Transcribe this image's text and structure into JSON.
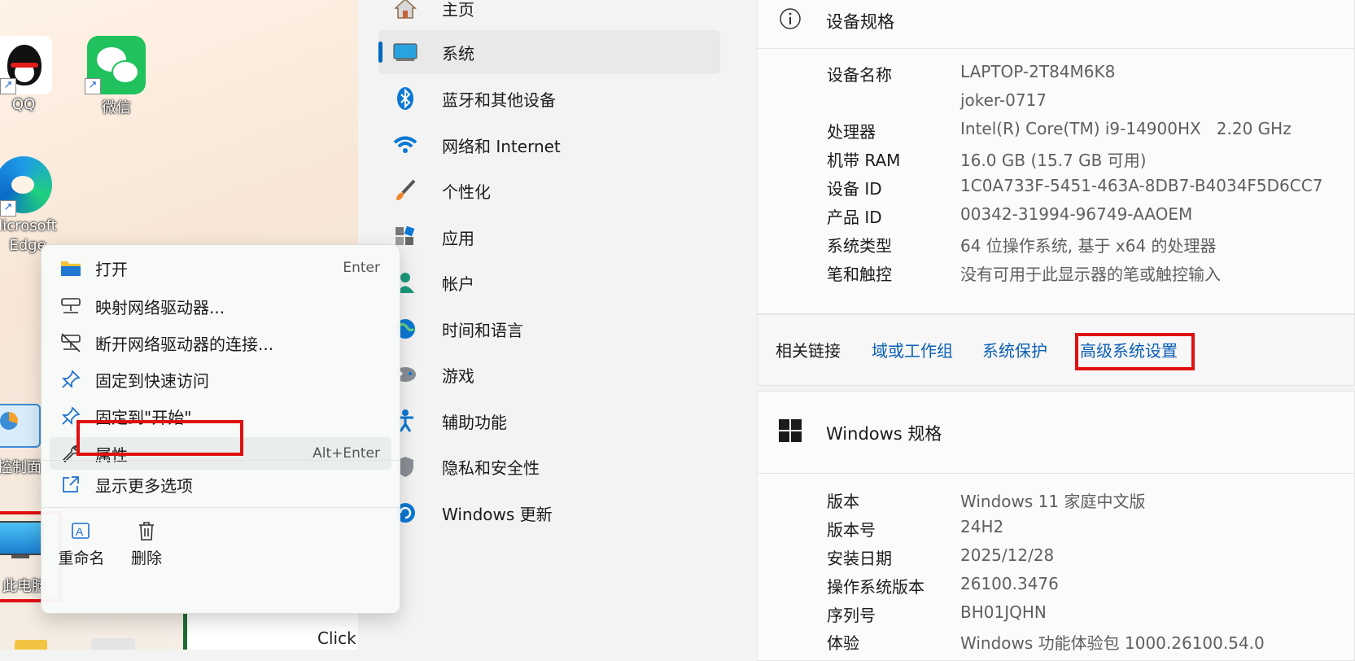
{
  "desktop": {
    "icons": [
      {
        "label": "QQ"
      },
      {
        "label": "微信"
      },
      {
        "label": "Microsoft Edge"
      },
      {
        "label": "控制面板"
      },
      {
        "label": "此电脑"
      }
    ],
    "edge_label_line1": "licrosoft",
    "edge_label_line2": "Edge",
    "cp_label": "控制面",
    "pc_label": "此电脑",
    "background_window_text": "Click"
  },
  "context_menu": {
    "items": [
      {
        "label": "打开",
        "shortcut": "Enter",
        "icon": "folder-icon"
      },
      {
        "label": "映射网络驱动器...",
        "icon": "network-drive-icon"
      },
      {
        "label": "断开网络驱动器的连接...",
        "icon": "disconnect-drive-icon"
      },
      {
        "label": "固定到快速访问",
        "icon": "pin-icon"
      },
      {
        "label": "固定到\"开始\"",
        "icon": "pin-icon"
      },
      {
        "label": "属性",
        "shortcut": "Alt+Enter",
        "icon": "wrench-icon"
      },
      {
        "label": "显示更多选项",
        "icon": "share-icon"
      }
    ],
    "bottom": [
      {
        "label": "重命名",
        "icon": "rename-icon"
      },
      {
        "label": "删除",
        "icon": "trash-icon"
      }
    ]
  },
  "nav": {
    "items": [
      {
        "label": "主页",
        "icon": "home-icon"
      },
      {
        "label": "系统",
        "icon": "display-icon"
      },
      {
        "label": "蓝牙和其他设备",
        "icon": "bluetooth-icon"
      },
      {
        "label": "网络和 Internet",
        "icon": "wifi-icon"
      },
      {
        "label": "个性化",
        "icon": "brush-icon"
      },
      {
        "label": "应用",
        "icon": "apps-icon"
      },
      {
        "label": "帐户",
        "icon": "account-icon"
      },
      {
        "label": "时间和语言",
        "icon": "globe-icon"
      },
      {
        "label": "游戏",
        "icon": "gamepad-icon"
      },
      {
        "label": "辅助功能",
        "icon": "accessibility-icon"
      },
      {
        "label": "隐私和安全性",
        "icon": "shield-icon"
      },
      {
        "label": "Windows 更新",
        "icon": "update-icon"
      }
    ]
  },
  "device_specs": {
    "title": "设备规格",
    "rows": [
      {
        "k": "设备名称",
        "v": "LAPTOP-2T84M6K8"
      },
      {
        "k": "",
        "v": "joker-0717"
      },
      {
        "k": "处理器",
        "v": "Intel(R) Core(TM) i9-14900HX   2.20 GHz"
      },
      {
        "k": "机带 RAM",
        "v": "16.0 GB (15.7 GB 可用)"
      },
      {
        "k": "设备 ID",
        "v": "1C0A733F-5451-463A-8DB7-B4034F5D6CC7"
      },
      {
        "k": "产品 ID",
        "v": "00342-31994-96749-AAOEM"
      },
      {
        "k": "系统类型",
        "v": "64 位操作系统, 基于 x64 的处理器"
      },
      {
        "k": "笔和触控",
        "v": "没有可用于此显示器的笔或触控输入"
      }
    ]
  },
  "related_links": {
    "label": "相关链接",
    "links": [
      "域或工作组",
      "系统保护",
      "高级系统设置"
    ]
  },
  "windows_specs": {
    "title": "Windows 规格",
    "rows": [
      {
        "k": "版本",
        "v": "Windows 11 家庭中文版"
      },
      {
        "k": "版本号",
        "v": "24H2"
      },
      {
        "k": "安装日期",
        "v": "2025/12/28"
      },
      {
        "k": "操作系统版本",
        "v": "26100.3476"
      },
      {
        "k": "序列号",
        "v": "BH01JQHN"
      },
      {
        "k": "体验",
        "v": "Windows 功能体验包 1000.26100.54.0"
      }
    ]
  },
  "colors": {
    "accent": "#0067c0",
    "highlight": "#e01010",
    "link": "#0a5fb4"
  }
}
